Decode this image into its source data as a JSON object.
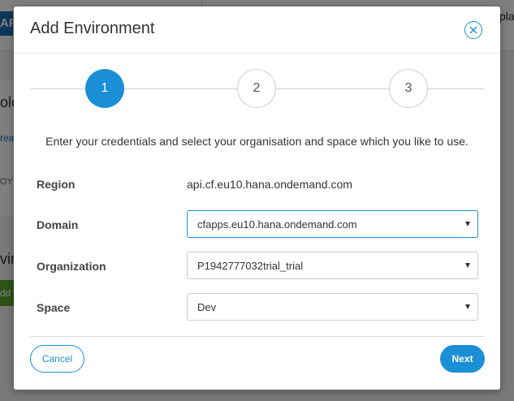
{
  "background": {
    "logo_text": "AP",
    "top_right_text": "pla",
    "section_title": "olo",
    "section_link": "reat",
    "section_caps": "OY",
    "section2_title": "viro",
    "green_button": "dd E"
  },
  "modal": {
    "title": "Add Environment",
    "steps": [
      "1",
      "2",
      "3"
    ],
    "active_step": 1,
    "instruction": "Enter your credentials and select your organisation and space which you like to use.",
    "form": {
      "region_label": "Region",
      "region_value": "api.cf.eu10.hana.ondemand.com",
      "domain_label": "Domain",
      "domain_value": "cfapps.eu10.hana.ondemand.com",
      "organization_label": "Organization",
      "organization_value": "P1942777032trial_trial",
      "space_label": "Space",
      "space_value": "Dev"
    },
    "cancel_label": "Cancel",
    "next_label": "Next"
  },
  "colors": {
    "accent": "#1a8fd6",
    "overlay": "rgba(0,0,0,0.5)"
  }
}
